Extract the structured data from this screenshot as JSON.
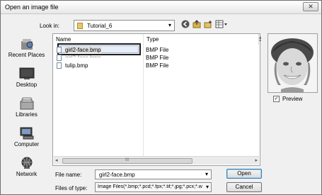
{
  "window": {
    "title": "Open an image file",
    "close_glyph": "✕"
  },
  "lookin": {
    "label": "Look in:",
    "value": "Tutorial_6"
  },
  "toolbar": {
    "icons": [
      "back-icon",
      "up-folder-icon",
      "new-folder-icon",
      "view-menu-icon"
    ]
  },
  "places": [
    {
      "label": "Recent Places",
      "icon": "recent-places-icon"
    },
    {
      "label": "Desktop",
      "icon": "desktop-icon"
    },
    {
      "label": "Libraries",
      "icon": "libraries-icon"
    },
    {
      "label": "Computer",
      "icon": "computer-icon"
    },
    {
      "label": "Network",
      "icon": "network-icon"
    }
  ],
  "filelist": {
    "headers": {
      "name": "Name",
      "type": "Type",
      "size": "S"
    },
    "rows": [
      {
        "name": "girl2-face.bmp",
        "type": "BMP File",
        "selected": true
      },
      {
        "name": "girl2-face.bmp",
        "type": "BMP File",
        "selected": false
      },
      {
        "name": "tulip.bmp",
        "type": "BMP File",
        "selected": false
      }
    ],
    "scroll_grip": "III"
  },
  "preview": {
    "label": "Preview",
    "checked": true,
    "check_glyph": "✓"
  },
  "file_name": {
    "label": "File name:",
    "value": "girl2-face.bmp"
  },
  "file_type": {
    "label": "Files of type:",
    "value": "Image Files(*.bmp;*.pcd;*.fpx;*.tif;*.jpg;*.pcx;*.w"
  },
  "buttons": {
    "open": "Open",
    "cancel": "Cancel"
  }
}
